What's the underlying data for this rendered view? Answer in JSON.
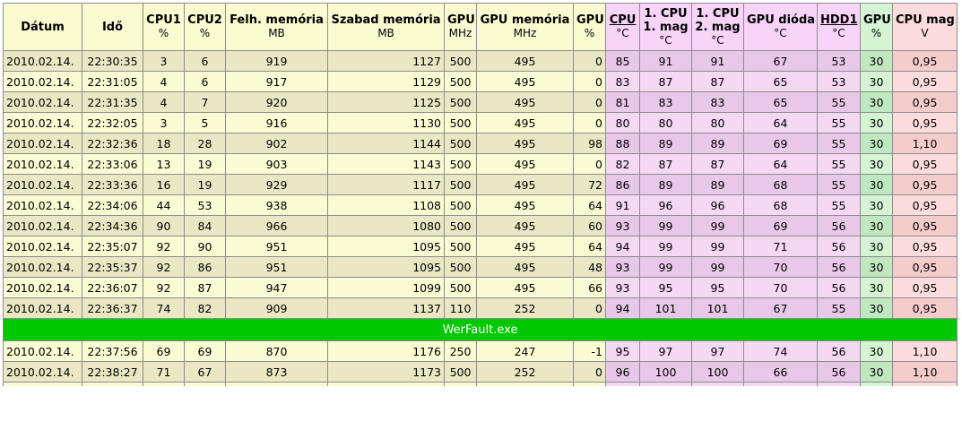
{
  "table": {
    "headers": [
      {
        "label": "Dátum",
        "unit": ""
      },
      {
        "label": "Idő",
        "unit": ""
      },
      {
        "label": "CPU1",
        "unit": "%"
      },
      {
        "label": "CPU2",
        "unit": "%"
      },
      {
        "label": "Felh. memória",
        "unit": "MB"
      },
      {
        "label": "Szabad memória",
        "unit": "MB"
      },
      {
        "label": "GPU",
        "unit": "MHz"
      },
      {
        "label": "GPU memória",
        "unit": "MHz"
      },
      {
        "label": "GPU",
        "unit": "%"
      },
      {
        "label": "CPU",
        "unit": "°C"
      },
      {
        "label1": "1. CPU",
        "label2": "1. mag",
        "unit": "°C"
      },
      {
        "label1": "1. CPU",
        "label2": "2. mag",
        "unit": "°C"
      },
      {
        "label": "GPU dióda",
        "unit": "°C"
      },
      {
        "label": "HDD1",
        "unit": "°C"
      },
      {
        "label": "GPU",
        "unit": "%"
      },
      {
        "label": "CPU mag",
        "unit": "V"
      }
    ],
    "rows": [
      [
        "2010.02.14.",
        "22:30:35",
        "3",
        "6",
        "919",
        "1127",
        "500",
        "495",
        "0",
        "85",
        "91",
        "91",
        "67",
        "53",
        "30",
        "0,95"
      ],
      [
        "2010.02.14.",
        "22:31:05",
        "4",
        "6",
        "917",
        "1129",
        "500",
        "495",
        "0",
        "83",
        "87",
        "87",
        "65",
        "53",
        "30",
        "0,95"
      ],
      [
        "2010.02.14.",
        "22:31:35",
        "4",
        "7",
        "920",
        "1125",
        "500",
        "495",
        "0",
        "81",
        "83",
        "83",
        "65",
        "55",
        "30",
        "0,95"
      ],
      [
        "2010.02.14.",
        "22:32:05",
        "3",
        "5",
        "916",
        "1130",
        "500",
        "495",
        "0",
        "80",
        "80",
        "80",
        "64",
        "55",
        "30",
        "0,95"
      ],
      [
        "2010.02.14.",
        "22:32:36",
        "18",
        "28",
        "902",
        "1144",
        "500",
        "495",
        "98",
        "88",
        "89",
        "89",
        "69",
        "55",
        "30",
        "1,10"
      ],
      [
        "2010.02.14.",
        "22:33:06",
        "13",
        "19",
        "903",
        "1143",
        "500",
        "495",
        "0",
        "82",
        "87",
        "87",
        "64",
        "55",
        "30",
        "0,95"
      ],
      [
        "2010.02.14.",
        "22:33:36",
        "16",
        "19",
        "929",
        "1117",
        "500",
        "495",
        "72",
        "86",
        "89",
        "89",
        "68",
        "55",
        "30",
        "0,95"
      ],
      [
        "2010.02.14.",
        "22:34:06",
        "44",
        "53",
        "938",
        "1108",
        "500",
        "495",
        "64",
        "91",
        "96",
        "96",
        "68",
        "55",
        "30",
        "0,95"
      ],
      [
        "2010.02.14.",
        "22:34:36",
        "90",
        "84",
        "966",
        "1080",
        "500",
        "495",
        "60",
        "93",
        "99",
        "99",
        "69",
        "56",
        "30",
        "0,95"
      ],
      [
        "2010.02.14.",
        "22:35:07",
        "92",
        "90",
        "951",
        "1095",
        "500",
        "495",
        "64",
        "94",
        "99",
        "99",
        "71",
        "56",
        "30",
        "0,95"
      ],
      [
        "2010.02.14.",
        "22:35:37",
        "92",
        "86",
        "951",
        "1095",
        "500",
        "495",
        "48",
        "93",
        "99",
        "99",
        "70",
        "56",
        "30",
        "0,95"
      ],
      [
        "2010.02.14.",
        "22:36:07",
        "92",
        "87",
        "947",
        "1099",
        "500",
        "495",
        "66",
        "93",
        "95",
        "95",
        "70",
        "56",
        "30",
        "0,95"
      ],
      [
        "2010.02.14.",
        "22:36:37",
        "74",
        "82",
        "909",
        "1137",
        "110",
        "252",
        "0",
        "94",
        "101",
        "101",
        "67",
        "55",
        "30",
        "0,95"
      ]
    ],
    "event_label": "WerFault.exe",
    "rows_after": [
      [
        "2010.02.14.",
        "22:37:56",
        "69",
        "69",
        "870",
        "1176",
        "250",
        "247",
        "-1",
        "95",
        "97",
        "97",
        "74",
        "56",
        "30",
        "1,10"
      ],
      [
        "2010.02.14.",
        "22:38:27",
        "71",
        "67",
        "873",
        "1173",
        "500",
        "252",
        "0",
        "96",
        "100",
        "100",
        "66",
        "56",
        "30",
        "1,10"
      ]
    ]
  }
}
